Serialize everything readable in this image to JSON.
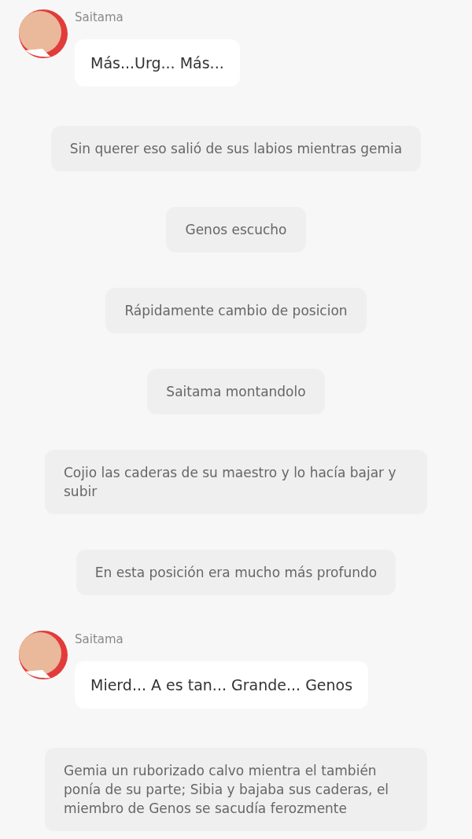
{
  "messages": [
    {
      "kind": "character",
      "name": "Saitama",
      "text": "Más...Urg... Más..."
    },
    {
      "kind": "narration",
      "text": "Sin querer eso salió de sus labios mientras gemia"
    },
    {
      "kind": "narration",
      "text": "Genos escucho"
    },
    {
      "kind": "narration",
      "text": "Rápidamente cambio de posicion"
    },
    {
      "kind": "narration",
      "text": "Saitama montandolo"
    },
    {
      "kind": "narration",
      "text": "Cojio las caderas de su maestro y lo hacía bajar y subir"
    },
    {
      "kind": "narration",
      "text": "En esta posición era mucho más profundo"
    },
    {
      "kind": "character",
      "name": "Saitama",
      "text": "Mierd... A es tan... Grande... Genos"
    },
    {
      "kind": "narration",
      "text": "Gemia un ruborizado calvo mientra el también ponía de su parte; Sibia y bajaba sus caderas, el miembro de Genos se sacudía ferozmente"
    }
  ]
}
